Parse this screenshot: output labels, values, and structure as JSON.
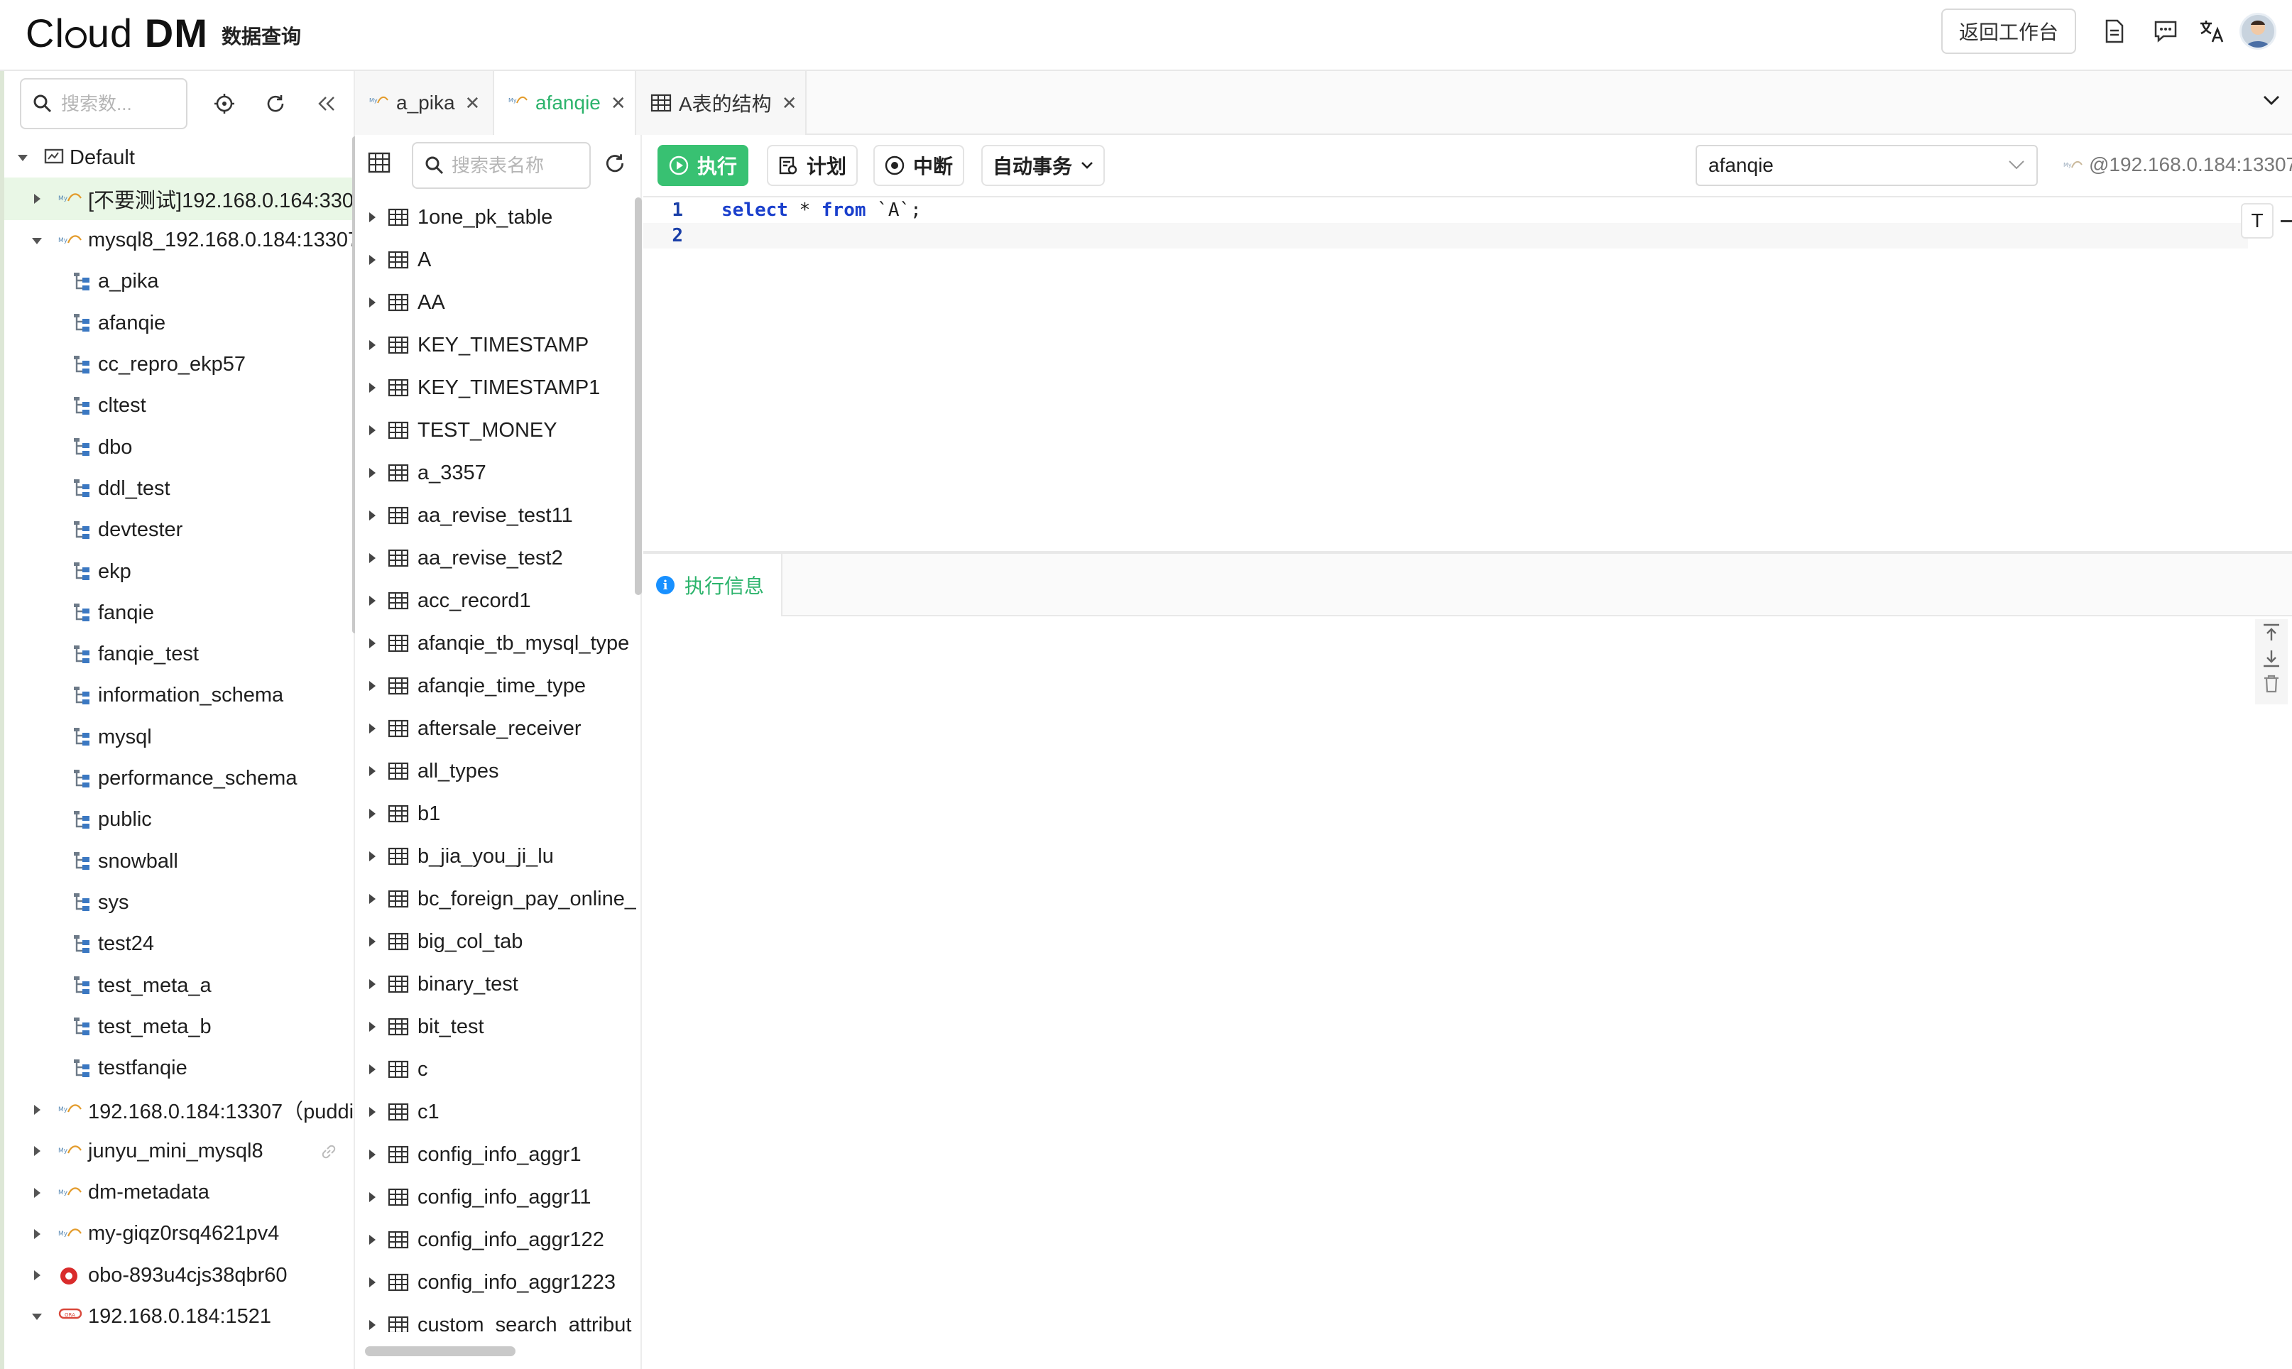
{
  "header": {
    "logo_text": "Cl",
    "logo_text2": "ud ",
    "logo_bold": "DM",
    "subtitle": "数据查询",
    "back_button": "返回工作台",
    "icons": [
      "document-icon",
      "chat-icon",
      "translate-icon"
    ]
  },
  "left_panel": {
    "search_placeholder": "搜索数...",
    "tree": [
      {
        "label": "Default",
        "level": 0,
        "expanded": true,
        "icon": "group-icon"
      },
      {
        "label": "[不要测试]192.168.0.164:330",
        "level": 1,
        "selected": true,
        "icon": "mysql-icon"
      },
      {
        "label": "mysql8_192.168.0.184:13307",
        "level": 1,
        "expanded": true,
        "icon": "mysql-icon"
      },
      {
        "label": "a_pika",
        "level": 2,
        "icon": "schema-icon"
      },
      {
        "label": "afanqie",
        "level": 2,
        "icon": "schema-icon"
      },
      {
        "label": "cc_repro_ekp57",
        "level": 2,
        "icon": "schema-icon"
      },
      {
        "label": "cltest",
        "level": 2,
        "icon": "schema-icon"
      },
      {
        "label": "dbo",
        "level": 2,
        "icon": "schema-icon"
      },
      {
        "label": "ddl_test",
        "level": 2,
        "icon": "schema-icon"
      },
      {
        "label": "devtester",
        "level": 2,
        "icon": "schema-icon"
      },
      {
        "label": "ekp",
        "level": 2,
        "icon": "schema-icon"
      },
      {
        "label": "fanqie",
        "level": 2,
        "icon": "schema-icon"
      },
      {
        "label": "fanqie_test",
        "level": 2,
        "icon": "schema-icon"
      },
      {
        "label": "information_schema",
        "level": 2,
        "icon": "schema-icon"
      },
      {
        "label": "mysql",
        "level": 2,
        "icon": "schema-icon"
      },
      {
        "label": "performance_schema",
        "level": 2,
        "icon": "schema-icon"
      },
      {
        "label": "public",
        "level": 2,
        "icon": "schema-icon"
      },
      {
        "label": "snowball",
        "level": 2,
        "icon": "schema-icon"
      },
      {
        "label": "sys",
        "level": 2,
        "icon": "schema-icon"
      },
      {
        "label": "test24",
        "level": 2,
        "icon": "schema-icon"
      },
      {
        "label": "test_meta_a",
        "level": 2,
        "icon": "schema-icon"
      },
      {
        "label": "test_meta_b",
        "level": 2,
        "icon": "schema-icon"
      },
      {
        "label": "testfanqie",
        "level": 2,
        "icon": "schema-icon"
      },
      {
        "label": "192.168.0.184:13307（puddi",
        "level": 1,
        "icon": "mysql-icon"
      },
      {
        "label": "junyu_mini_mysql8",
        "level": 1,
        "icon": "mysql-icon",
        "link": true
      },
      {
        "label": "dm-metadata",
        "level": 1,
        "icon": "mysql-icon"
      },
      {
        "label": "my-giqz0rsq4621pv4",
        "level": 1,
        "icon": "mysql-icon"
      },
      {
        "label": "obo-893u4cjs38qbr60",
        "level": 1,
        "icon": "oceanbase-icon"
      },
      {
        "label": "192.168.0.184:1521",
        "level": 1,
        "expanded": true,
        "icon": "oracle-icon"
      }
    ]
  },
  "tabs": [
    {
      "label": "a_pika",
      "icon": "mysql-icon",
      "active": false
    },
    {
      "label": "afanqie",
      "icon": "mysql-icon",
      "active": true
    },
    {
      "label": "A表的结构",
      "icon": "table-icon",
      "active": false
    }
  ],
  "table_list": {
    "search_placeholder": "搜索表名称",
    "tables": [
      "1one_pk_table",
      "A",
      "AA",
      "KEY_TIMESTAMP",
      "KEY_TIMESTAMP1",
      "TEST_MONEY",
      "a_3357",
      "aa_revise_test11",
      "aa_revise_test2",
      "acc_record1",
      "afanqie_tb_mysql_type",
      "afanqie_time_type",
      "aftersale_receiver",
      "all_types",
      "b1",
      "b_jia_you_ji_lu",
      "bc_foreign_pay_online_",
      "big_col_tab",
      "binary_test",
      "bit_test",
      "c",
      "c1",
      "config_info_aggr1",
      "config_info_aggr11",
      "config_info_aggr122",
      "config_info_aggr1223",
      "custom_search_attribut"
    ]
  },
  "toolbar": {
    "run_label": "执行",
    "plan_label": "计划",
    "stop_label": "中断",
    "transaction_label": "自动事务",
    "database_value": "afanqie",
    "connection_host": "@192.168.0.184:13307"
  },
  "editor": {
    "lines": [
      {
        "number": "1",
        "parts": [
          {
            "t": "select",
            "kw": true
          },
          {
            "t": " * "
          },
          {
            "t": "from",
            "kw": true
          },
          {
            "t": " `A`;"
          }
        ]
      },
      {
        "number": "2",
        "parts": []
      }
    ],
    "format_button": "T"
  },
  "result": {
    "tab_label": "执行信息",
    "info_glyph": "i"
  },
  "colors": {
    "accent": "#38c172",
    "active_tab_text": "#2bb36b",
    "keyword": "#1a3fcc",
    "selected_row": "#e9f7e6"
  }
}
